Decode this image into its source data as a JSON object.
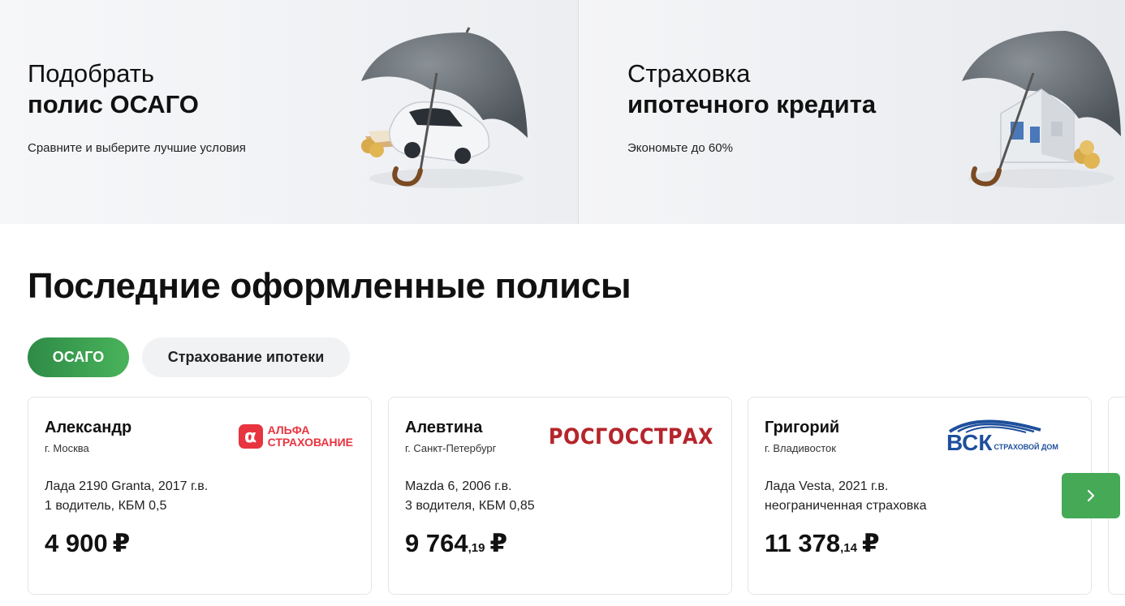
{
  "banners": [
    {
      "line1": "Подобрать",
      "line2": "полис ОСАГО",
      "subtitle": "Сравните и выберите лучшие условия"
    },
    {
      "line1": "Страховка",
      "line2": "ипотечного кредита",
      "subtitle": "Экономьте до 60%"
    }
  ],
  "section": {
    "title": "Последние оформленные полисы"
  },
  "tabs": [
    {
      "label": "ОСАГО",
      "active": true
    },
    {
      "label": "Страхование ипотеки",
      "active": false
    }
  ],
  "policies": [
    {
      "name": "Александр",
      "city": "г. Москва",
      "insurer": {
        "logo_mark": "α",
        "logo_line1": "АЛЬФА",
        "logo_line2": "СТРАХОВАНИЕ",
        "color": "#e8343f"
      },
      "car": "Лада 2190 Granta, 2017 г.в.",
      "drivers": "1 водитель, КБМ 0,5",
      "price_main": "4 900",
      "price_kop": "",
      "currency": "₽"
    },
    {
      "name": "Алевтина",
      "city": "г. Санкт-Петербург",
      "insurer": {
        "logo_text": "РОСГОССТРАХ",
        "color": "#b5252b"
      },
      "car": "Mazda 6, 2006 г.в.",
      "drivers": "3 водителя, КБМ 0,85",
      "price_main": "9 764",
      "price_kop": ",19",
      "currency": "₽"
    },
    {
      "name": "Григорий",
      "city": "г. Владивосток",
      "insurer": {
        "logo_mark": "ВСК",
        "logo_tail": "СТРАХОВОЙ ДОМ",
        "color": "#1e4f9c"
      },
      "car": "Лада Vesta, 2021 г.в.",
      "drivers": "неограниченная страховка",
      "price_main": "11 378",
      "price_kop": ",14",
      "currency": "₽"
    }
  ],
  "icons": {
    "banner1": "umbrella-car-icon",
    "banner2": "umbrella-house-icon",
    "next": "chevron-right-icon"
  },
  "colors": {
    "accent_green": "#45a956",
    "alfa_red": "#e8343f",
    "rgs_red": "#b5252b",
    "vsk_blue": "#1e4f9c"
  }
}
